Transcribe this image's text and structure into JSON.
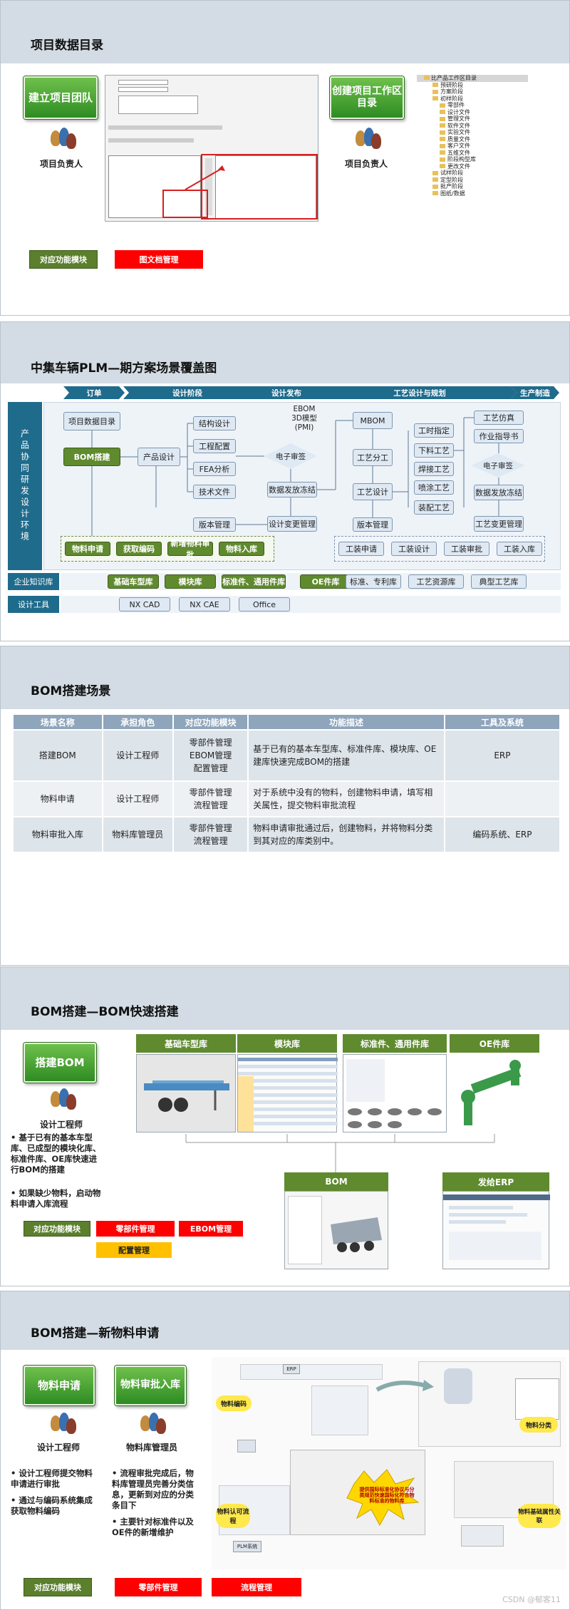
{
  "slide1": {
    "title": "项目数据目录",
    "btn_team": "建立项目团队",
    "btn_dir": "创建项目工作区目录",
    "role_left": "项目负责人",
    "role_right": "项目负责人",
    "tag_module": "对应功能模块",
    "tag_doc": "图文档管理",
    "tree_root": "比产品工作区目录",
    "tree_items": [
      "预研阶段",
      "方案阶段",
      "初样阶段",
      "零部件",
      "设计文件",
      "管理文件",
      "软件文件",
      "实验文件",
      "质量文件",
      "客户文件",
      "五维文件",
      "阶段构型库",
      "更改文件",
      "试样阶段",
      "定型阶段",
      "批产阶段",
      "图纸/数据"
    ]
  },
  "slide2": {
    "title": "中集车辆PLM—期方案场景覆盖图",
    "phases": [
      "订单",
      "设计阶段",
      "设计发布",
      "工艺设计与规划",
      "生产制造"
    ],
    "side_labels": {
      "env": "产品协同研发设计环境",
      "kb": "企业知识库",
      "tools": "设计工具"
    },
    "boxes": {
      "proj_dir": "项目数据目录",
      "bom_build": "BOM搭建",
      "prod_design": "产品设计",
      "struct_design": "结构设计",
      "eng_config": "工程配置",
      "fea": "FEA分析",
      "tech_doc": "技术文件",
      "ebom": "EBOM\n3D模型\n(PMI)",
      "e_sign1": "电子审签",
      "data_release1": "数据发放冻结",
      "version_mgmt1": "版本管理",
      "design_change": "设计变更管理",
      "mbom": "MBOM",
      "proc_div": "工艺分工",
      "proc_design": "工艺设计",
      "version_mgmt2": "版本管理",
      "work_hours": "工时指定",
      "cutting": "下料工艺",
      "welding": "焊接工艺",
      "painting": "喷涂工艺",
      "assembly": "装配工艺",
      "proc_sim": "工艺仿真",
      "work_guide": "作业指导书",
      "e_sign2": "电子审签",
      "data_release2": "数据发放冻结",
      "proc_change": "工艺变更管理"
    },
    "flow_green": [
      "物料申请",
      "获取编码",
      "新增物料审批",
      "物料入库"
    ],
    "flow_blue": [
      "工装申请",
      "工装设计",
      "工装审批",
      "工装入库"
    ],
    "kb_green": [
      "基础车型库",
      "模块库",
      "标准件、通用件库",
      "OE件库"
    ],
    "kb_blue": [
      "标准、专利库",
      "工艺资源库",
      "典型工艺库"
    ],
    "tools": [
      "NX CAD",
      "NX CAE",
      "Office"
    ]
  },
  "slide3": {
    "title": "BOM搭建场景",
    "headers": [
      "场景名称",
      "承担角色",
      "对应功能模块",
      "功能描述",
      "工具及系统"
    ],
    "rows": [
      [
        "搭建BOM",
        "设计工程师",
        "零部件管理\nEBOM管理\n配置管理",
        "基于已有的基本车型库、标准件库、模块库、OE建库快速完成BOM的搭建",
        "ERP"
      ],
      [
        "物料申请",
        "设计工程师",
        "零部件管理\n流程管理",
        "对于系统中没有的物料，创建物料申请，填写相关属性，提交物料审批流程",
        ""
      ],
      [
        "物料审批入库",
        "物料库管理员",
        "零部件管理\n流程管理",
        "物料申请审批通过后，创建物料，并将物料分类到其对应的库类别中。",
        "编码系统、ERP"
      ]
    ]
  },
  "slide4": {
    "title": "BOM搭建—BOM快速搭建",
    "btn": "搭建BOM",
    "role": "设计工程师",
    "bullets": [
      "基于已有的基本车型库、已成型的模块化库、标准件库、OE库快速进行BOM的搭建",
      "如果缺少物料，启动物料申请入库流程"
    ],
    "caps": [
      "基础车型库",
      "模块库",
      "标准件、通用件库",
      "OE件库",
      "BOM",
      "发给ERP"
    ],
    "tag_module": "对应功能模块",
    "tag_parts": "零部件管理",
    "tag_ebom": "EBOM管理",
    "tag_config": "配置管理"
  },
  "slide5": {
    "title": "BOM搭建—新物料申请",
    "btn_apply": "物料申请",
    "btn_approve": "物料审批入库",
    "role_left": "设计工程师",
    "role_right": "物料库管理员",
    "bullets_left": [
      "设计工程师提交物料申请进行审批",
      "通过与编码系统集成获取物料编码"
    ],
    "bullets_right": [
      "流程审批完成后，物料库管理员完善分类信息，更新到对应的分类条目下",
      "主要针对标准件以及OE件的新增维护"
    ],
    "diagram_labels": {
      "material_code": "物料编码",
      "material_class": "物料分类",
      "approve_flow": "物料认可流程",
      "collab": "物料基础属性关联",
      "burst": "提供国际标准化协议与分类规范快速国际化符合物料标准的物料库",
      "plm": "PLM系统",
      "erp": "ERP"
    },
    "tag_module": "对应功能模块",
    "tag_parts": "零部件管理",
    "tag_flow": "流程管理"
  },
  "watermark": "CSDN @郁客11",
  "colors": {
    "green": "#3c9a2b",
    "red": "#ff0000",
    "header_blue": "#d3dce4",
    "chevron": "#1f6b8c"
  }
}
